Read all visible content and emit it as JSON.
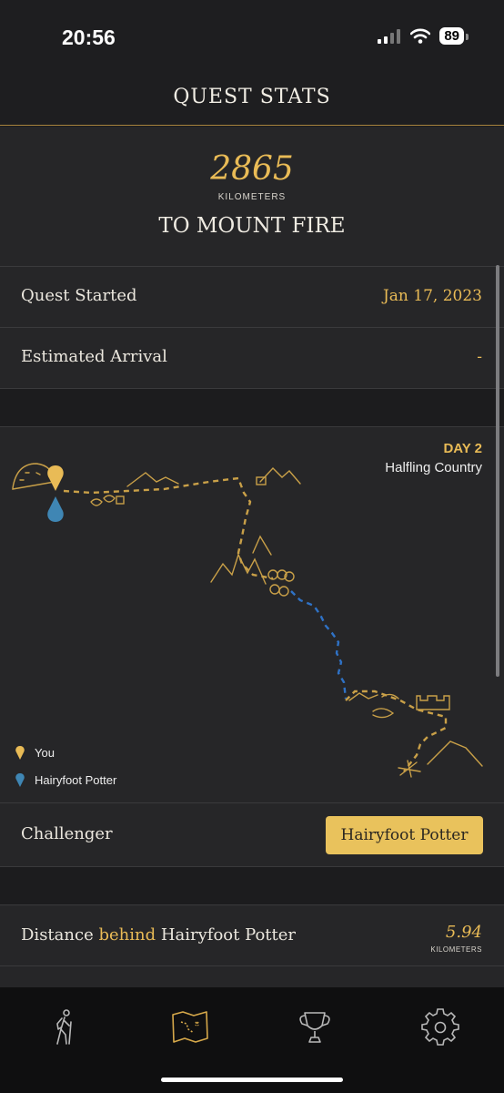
{
  "status": {
    "time": "20:56",
    "battery": "89"
  },
  "header": {
    "title": "QUEST STATS"
  },
  "hero": {
    "distance": "2865",
    "unit": "KILOMETERS",
    "destination": "TO MOUNT FIRE"
  },
  "rows": {
    "started_label": "Quest Started",
    "started_value": "Jan 17, 2023",
    "arrival_label": "Estimated Arrival",
    "arrival_value": "-"
  },
  "map": {
    "day": "DAY 2",
    "region": "Halfling Country",
    "legend": [
      {
        "label": "You",
        "color": "#e9bb56"
      },
      {
        "label": "Hairyfoot Potter",
        "color": "#3f86b4"
      }
    ]
  },
  "challenger": {
    "label": "Challenger",
    "button": "Hairyfoot Potter"
  },
  "distance": {
    "prefix": "Distance",
    "emphasis": "behind",
    "name": "Hairyfoot Potter",
    "value": "5.94",
    "unit": "KILOMETERS"
  },
  "tabs": [
    {
      "icon": "hiker-icon"
    },
    {
      "icon": "map-icon",
      "active": true
    },
    {
      "icon": "trophy-icon"
    },
    {
      "icon": "gear-icon"
    }
  ],
  "colors": {
    "accent": "#e9bb56",
    "challenger": "#3f86b4",
    "button": "#e9c25c"
  }
}
